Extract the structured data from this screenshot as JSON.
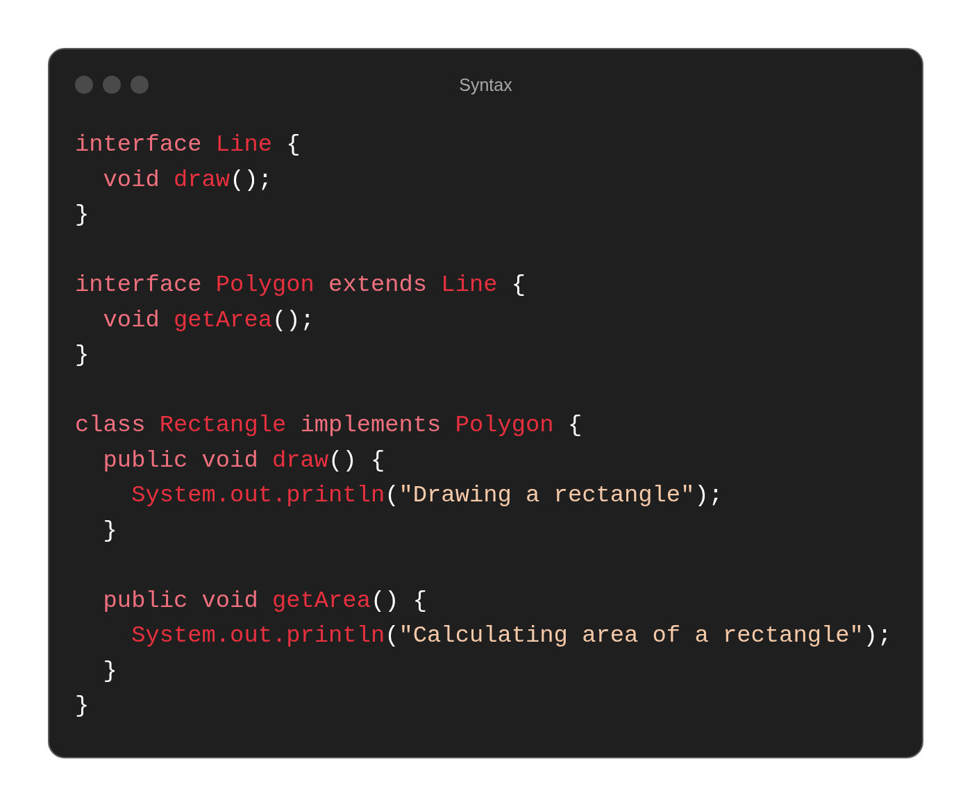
{
  "window": {
    "title": "Syntax"
  },
  "code_lines": [
    {
      "kind": "code",
      "tokens": [
        {
          "kind": "keyword",
          "text": "interface "
        },
        {
          "kind": "name",
          "text": "Line"
        },
        {
          "kind": "punct",
          "text": " {"
        }
      ]
    },
    {
      "kind": "code",
      "tokens": [
        {
          "kind": "keyword",
          "text": "  void "
        },
        {
          "kind": "name",
          "text": "draw"
        },
        {
          "kind": "punct",
          "text": "();"
        }
      ]
    },
    {
      "kind": "code",
      "tokens": [
        {
          "kind": "punct",
          "text": "}"
        }
      ]
    },
    {
      "kind": "blank"
    },
    {
      "kind": "code",
      "tokens": [
        {
          "kind": "keyword",
          "text": "interface "
        },
        {
          "kind": "name",
          "text": "Polygon"
        },
        {
          "kind": "keyword",
          "text": " extends "
        },
        {
          "kind": "name",
          "text": "Line"
        },
        {
          "kind": "punct",
          "text": " {"
        }
      ]
    },
    {
      "kind": "code",
      "tokens": [
        {
          "kind": "keyword",
          "text": "  void "
        },
        {
          "kind": "name",
          "text": "getArea"
        },
        {
          "kind": "punct",
          "text": "();"
        }
      ]
    },
    {
      "kind": "code",
      "tokens": [
        {
          "kind": "punct",
          "text": "}"
        }
      ]
    },
    {
      "kind": "blank"
    },
    {
      "kind": "code",
      "tokens": [
        {
          "kind": "keyword",
          "text": "class "
        },
        {
          "kind": "name",
          "text": "Rectangle"
        },
        {
          "kind": "keyword",
          "text": " implements "
        },
        {
          "kind": "name",
          "text": "Polygon"
        },
        {
          "kind": "punct",
          "text": " {"
        }
      ]
    },
    {
      "kind": "code",
      "tokens": [
        {
          "kind": "keyword",
          "text": "  public void "
        },
        {
          "kind": "name",
          "text": "draw"
        },
        {
          "kind": "punct",
          "text": "() {"
        }
      ]
    },
    {
      "kind": "code",
      "tokens": [
        {
          "kind": "name",
          "text": "    System.out.println"
        },
        {
          "kind": "punct",
          "text": "("
        },
        {
          "kind": "string",
          "text": "\"Drawing a rectangle\""
        },
        {
          "kind": "punct",
          "text": ");"
        }
      ]
    },
    {
      "kind": "code",
      "tokens": [
        {
          "kind": "punct",
          "text": "  }"
        }
      ]
    },
    {
      "kind": "blank"
    },
    {
      "kind": "code",
      "tokens": [
        {
          "kind": "keyword",
          "text": "  public void "
        },
        {
          "kind": "name",
          "text": "getArea"
        },
        {
          "kind": "punct",
          "text": "() {"
        }
      ]
    },
    {
      "kind": "code",
      "tokens": [
        {
          "kind": "name",
          "text": "    System.out.println"
        },
        {
          "kind": "punct",
          "text": "("
        },
        {
          "kind": "string",
          "text": "\"Calculating area of a rectangle\""
        },
        {
          "kind": "punct",
          "text": ");"
        }
      ]
    },
    {
      "kind": "code",
      "tokens": [
        {
          "kind": "punct",
          "text": "  }"
        }
      ]
    },
    {
      "kind": "code",
      "tokens": [
        {
          "kind": "punct",
          "text": "}"
        }
      ]
    }
  ]
}
